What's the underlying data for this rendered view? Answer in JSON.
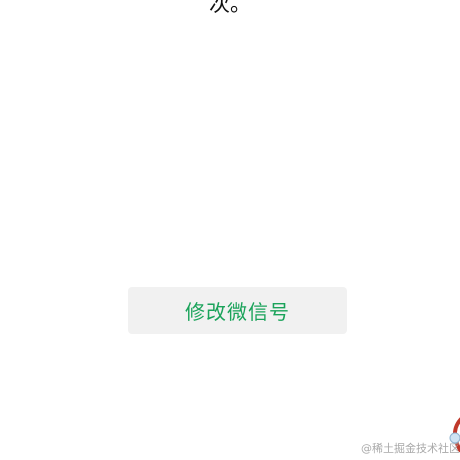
{
  "top_text": "次。",
  "primary_button": {
    "label": "修改微信号",
    "color": "#1aa35a",
    "background": "#f1f1f1"
  },
  "watermark": "@稀土掘金技术社区"
}
